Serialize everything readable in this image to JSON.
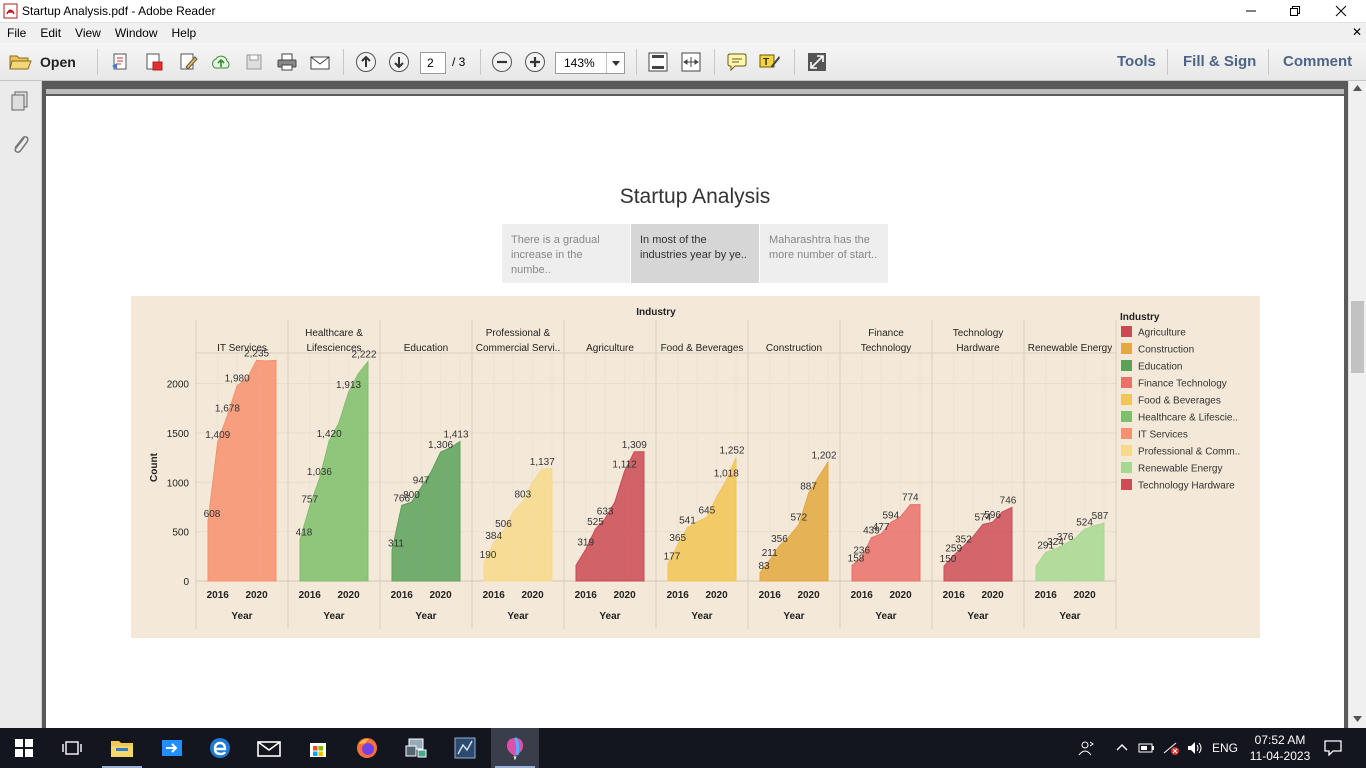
{
  "window": {
    "title": "Startup Analysis.pdf - Adobe Reader"
  },
  "menu": [
    "File",
    "Edit",
    "View",
    "Window",
    "Help"
  ],
  "toolbar": {
    "open_label": "Open",
    "page_current": "2",
    "page_total": "/ 3",
    "zoom": "143%",
    "tools_label": "Tools",
    "fill_sign_label": "Fill & Sign",
    "comment_label": "Comment"
  },
  "document": {
    "title": "Startup Analysis",
    "story_points": [
      "There is a gradual increase in the numbe..",
      "In most of the industries year by ye..",
      "Maharashtra has the more number of start.."
    ],
    "active_story": 1
  },
  "chart_data": {
    "type": "area",
    "title": "Industry",
    "ylabel": "Count",
    "xlabel": "Year",
    "x_ticks": [
      "2016",
      "2020"
    ],
    "y_ticks": [
      0,
      500,
      1000,
      1500,
      2000
    ],
    "ylim": [
      0,
      2300
    ],
    "grid": true,
    "legend_title": "Industry",
    "legend_position": "right",
    "legend": [
      {
        "name": "Agriculture",
        "color": "#c94a55"
      },
      {
        "name": "Construction",
        "color": "#e3a840"
      },
      {
        "name": "Education",
        "color": "#5aa25a"
      },
      {
        "name": "Finance Technology",
        "color": "#e9706b"
      },
      {
        "name": "Food & Beverages",
        "color": "#f1c655"
      },
      {
        "name": "Healthcare & Lifescie..",
        "color": "#7ebf6c"
      },
      {
        "name": "IT Services",
        "color": "#f6906f"
      },
      {
        "name": "Professional & Comm..",
        "color": "#f7d98b"
      },
      {
        "name": "Renewable Energy",
        "color": "#a7d892"
      },
      {
        "name": "Technology Hardware",
        "color": "#cc4d58"
      }
    ],
    "series": [
      {
        "name": "IT Services",
        "header": [
          "",
          "IT Services"
        ],
        "color": "#f6906f",
        "x": [
          2015,
          2016,
          2017,
          2018,
          2019,
          2020,
          2021,
          2022
        ],
        "values": [
          608,
          1409,
          1678,
          1980,
          2045,
          2235,
          2230,
          2235
        ],
        "labels": [
          "608",
          "1,409",
          "1,678",
          "1,980",
          "2,235"
        ]
      },
      {
        "name": "Healthcare & Lifesciences",
        "header": [
          "Healthcare &",
          "Lifesciences"
        ],
        "color": "#7ebf6c",
        "x": [
          2015,
          2016,
          2017,
          2018,
          2019,
          2020,
          2021,
          2022
        ],
        "values": [
          418,
          757,
          1036,
          1420,
          1600,
          1913,
          2100,
          2222
        ],
        "labels": [
          "418",
          "757",
          "1,036",
          "1,420",
          "1,913",
          "2,222"
        ]
      },
      {
        "name": "Education",
        "header": [
          "",
          "Education"
        ],
        "color": "#5aa25a",
        "x": [
          2015,
          2016,
          2017,
          2018,
          2019,
          2020,
          2021,
          2022
        ],
        "values": [
          311,
          766,
          800,
          947,
          1100,
          1306,
          1350,
          1413
        ],
        "labels": [
          "311",
          "766",
          "800",
          "947",
          "1,306",
          "1,413"
        ]
      },
      {
        "name": "Professional & Commercial Services",
        "header": [
          "Professional &",
          "Commercial Servi.."
        ],
        "color": "#f7d98b",
        "x": [
          2015,
          2016,
          2017,
          2018,
          2019,
          2020,
          2021,
          2022
        ],
        "values": [
          190,
          384,
          506,
          700,
          803,
          1000,
          1137,
          1137
        ],
        "labels": [
          "190",
          "384",
          "506",
          "803",
          "1,137"
        ]
      },
      {
        "name": "Agriculture",
        "header": [
          "",
          "Agriculture"
        ],
        "color": "#c94a55",
        "x": [
          2015,
          2016,
          2017,
          2018,
          2019,
          2020,
          2021,
          2022
        ],
        "values": [
          160,
          319,
          525,
          633,
          800,
          1112,
          1309,
          1309
        ],
        "labels": [
          "319",
          "525",
          "633",
          "1,112",
          "1,309"
        ]
      },
      {
        "name": "Food & Beverages",
        "header": [
          "",
          "Food & Beverages"
        ],
        "color": "#f1c655",
        "x": [
          2015,
          2016,
          2017,
          2018,
          2019,
          2020,
          2021,
          2022
        ],
        "values": [
          177,
          365,
          541,
          600,
          645,
          850,
          1018,
          1252
        ],
        "labels": [
          "177",
          "365",
          "541",
          "645",
          "1,018",
          "1,252"
        ]
      },
      {
        "name": "Construction",
        "header": [
          "",
          "Construction"
        ],
        "color": "#e3a840",
        "x": [
          2015,
          2016,
          2017,
          2018,
          2019,
          2020,
          2021,
          2022
        ],
        "values": [
          83,
          211,
          356,
          450,
          572,
          887,
          1050,
          1202
        ],
        "labels": [
          "83",
          "211",
          "356",
          "572",
          "887",
          "1,202"
        ]
      },
      {
        "name": "Finance Technology",
        "header": [
          "Finance",
          "Technology"
        ],
        "color": "#e9706b",
        "x": [
          2015,
          2016,
          2017,
          2018,
          2019,
          2020,
          2021,
          2022
        ],
        "values": [
          158,
          236,
          439,
          477,
          594,
          650,
          774,
          774
        ],
        "labels": [
          "158",
          "236",
          "439",
          "477",
          "594",
          "774"
        ]
      },
      {
        "name": "Technology Hardware",
        "header": [
          "Technology",
          "Hardware"
        ],
        "color": "#cc4d58",
        "x": [
          2015,
          2016,
          2017,
          2018,
          2019,
          2020,
          2021,
          2022
        ],
        "values": [
          150,
          259,
          352,
          450,
          574,
          596,
          700,
          746
        ],
        "labels": [
          "150",
          "259",
          "352",
          "574",
          "596",
          "746"
        ]
      },
      {
        "name": "Renewable Energy",
        "header": [
          "",
          "Renewable Energy"
        ],
        "color": "#a7d892",
        "x": [
          2015,
          2016,
          2017,
          2018,
          2019,
          2020,
          2021,
          2022
        ],
        "values": [
          150,
          291,
          324,
          376,
          430,
          524,
          560,
          587
        ],
        "labels": [
          "291",
          "324",
          "376",
          "524",
          "587"
        ]
      }
    ]
  },
  "taskbar": {
    "language": "ENG",
    "time": "07:52 AM",
    "date": "11-04-2023"
  }
}
